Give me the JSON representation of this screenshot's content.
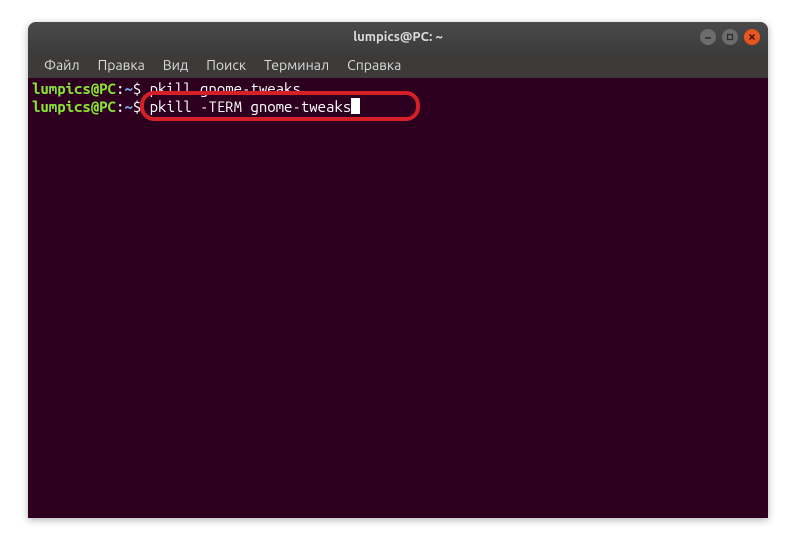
{
  "window": {
    "title": "lumpics@PC: ~"
  },
  "menubar": {
    "items": [
      "Файл",
      "Правка",
      "Вид",
      "Поиск",
      "Терминал",
      "Справка"
    ]
  },
  "prompt": {
    "user": "lumpics",
    "at": "@",
    "host": "PC",
    "colon": ":",
    "path": "~",
    "dollar": "$ "
  },
  "lines": [
    {
      "command": "pkill gnome-tweaks",
      "cursor": false
    },
    {
      "command": "pkill -TERM gnome-tweaks",
      "cursor": true
    }
  ]
}
